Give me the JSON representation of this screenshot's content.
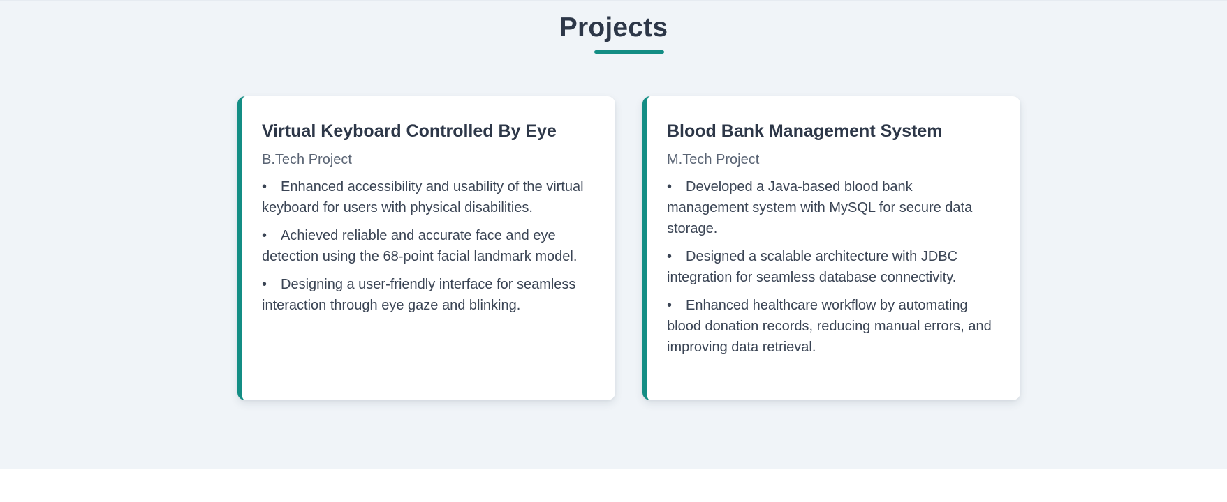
{
  "section": {
    "title": "Projects"
  },
  "projects": [
    {
      "title": "Virtual Keyboard Controlled By Eye",
      "subtitle": "B.Tech Project",
      "bullets": [
        "Enhanced accessibility and usability of the virtual keyboard for users with physical disabilities.",
        "Achieved reliable and accurate face and eye detection using the 68-point facial landmark model.",
        "Designing a user-friendly interface for seamless interaction through eye gaze and blinking."
      ]
    },
    {
      "title": "Blood Bank Management System",
      "subtitle": "M.Tech Project",
      "bullets": [
        "Developed a Java-based blood bank management system with MySQL for secure data storage.",
        "Designed a scalable architecture with JDBC integration for seamless database connectivity.",
        "Enhanced healthcare workflow by automating blood donation records, reducing manual errors, and improving data retrieval."
      ]
    }
  ],
  "colors": {
    "accent": "#138d84",
    "background": "#f0f4f8",
    "card": "#ffffff",
    "text": "#2d3748"
  },
  "bullet_symbol": "•"
}
